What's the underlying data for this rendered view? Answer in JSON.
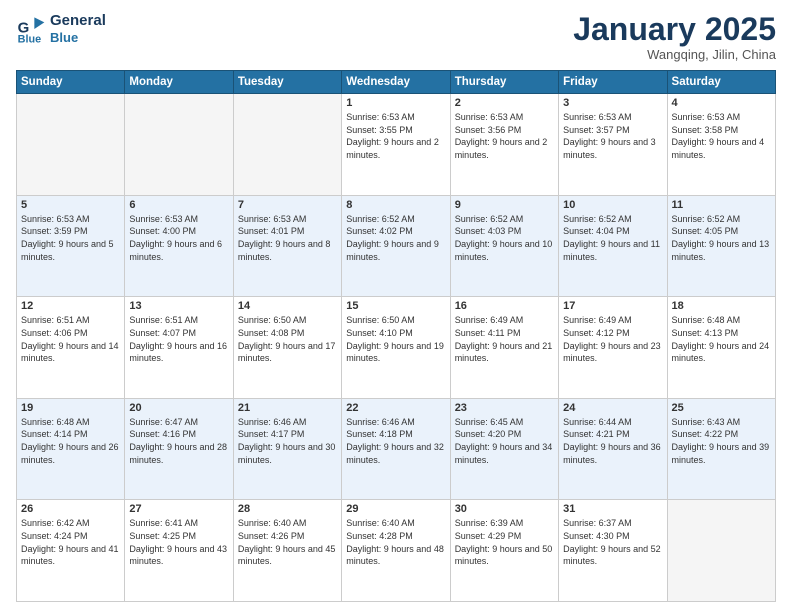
{
  "header": {
    "logo_line1": "General",
    "logo_line2": "Blue",
    "month": "January 2025",
    "location": "Wangqing, Jilin, China"
  },
  "weekdays": [
    "Sunday",
    "Monday",
    "Tuesday",
    "Wednesday",
    "Thursday",
    "Friday",
    "Saturday"
  ],
  "weeks": [
    [
      {
        "day": "",
        "info": ""
      },
      {
        "day": "",
        "info": ""
      },
      {
        "day": "",
        "info": ""
      },
      {
        "day": "1",
        "info": "Sunrise: 6:53 AM\nSunset: 3:55 PM\nDaylight: 9 hours and 2 minutes."
      },
      {
        "day": "2",
        "info": "Sunrise: 6:53 AM\nSunset: 3:56 PM\nDaylight: 9 hours and 2 minutes."
      },
      {
        "day": "3",
        "info": "Sunrise: 6:53 AM\nSunset: 3:57 PM\nDaylight: 9 hours and 3 minutes."
      },
      {
        "day": "4",
        "info": "Sunrise: 6:53 AM\nSunset: 3:58 PM\nDaylight: 9 hours and 4 minutes."
      }
    ],
    [
      {
        "day": "5",
        "info": "Sunrise: 6:53 AM\nSunset: 3:59 PM\nDaylight: 9 hours and 5 minutes."
      },
      {
        "day": "6",
        "info": "Sunrise: 6:53 AM\nSunset: 4:00 PM\nDaylight: 9 hours and 6 minutes."
      },
      {
        "day": "7",
        "info": "Sunrise: 6:53 AM\nSunset: 4:01 PM\nDaylight: 9 hours and 8 minutes."
      },
      {
        "day": "8",
        "info": "Sunrise: 6:52 AM\nSunset: 4:02 PM\nDaylight: 9 hours and 9 minutes."
      },
      {
        "day": "9",
        "info": "Sunrise: 6:52 AM\nSunset: 4:03 PM\nDaylight: 9 hours and 10 minutes."
      },
      {
        "day": "10",
        "info": "Sunrise: 6:52 AM\nSunset: 4:04 PM\nDaylight: 9 hours and 11 minutes."
      },
      {
        "day": "11",
        "info": "Sunrise: 6:52 AM\nSunset: 4:05 PM\nDaylight: 9 hours and 13 minutes."
      }
    ],
    [
      {
        "day": "12",
        "info": "Sunrise: 6:51 AM\nSunset: 4:06 PM\nDaylight: 9 hours and 14 minutes."
      },
      {
        "day": "13",
        "info": "Sunrise: 6:51 AM\nSunset: 4:07 PM\nDaylight: 9 hours and 16 minutes."
      },
      {
        "day": "14",
        "info": "Sunrise: 6:50 AM\nSunset: 4:08 PM\nDaylight: 9 hours and 17 minutes."
      },
      {
        "day": "15",
        "info": "Sunrise: 6:50 AM\nSunset: 4:10 PM\nDaylight: 9 hours and 19 minutes."
      },
      {
        "day": "16",
        "info": "Sunrise: 6:49 AM\nSunset: 4:11 PM\nDaylight: 9 hours and 21 minutes."
      },
      {
        "day": "17",
        "info": "Sunrise: 6:49 AM\nSunset: 4:12 PM\nDaylight: 9 hours and 23 minutes."
      },
      {
        "day": "18",
        "info": "Sunrise: 6:48 AM\nSunset: 4:13 PM\nDaylight: 9 hours and 24 minutes."
      }
    ],
    [
      {
        "day": "19",
        "info": "Sunrise: 6:48 AM\nSunset: 4:14 PM\nDaylight: 9 hours and 26 minutes."
      },
      {
        "day": "20",
        "info": "Sunrise: 6:47 AM\nSunset: 4:16 PM\nDaylight: 9 hours and 28 minutes."
      },
      {
        "day": "21",
        "info": "Sunrise: 6:46 AM\nSunset: 4:17 PM\nDaylight: 9 hours and 30 minutes."
      },
      {
        "day": "22",
        "info": "Sunrise: 6:46 AM\nSunset: 4:18 PM\nDaylight: 9 hours and 32 minutes."
      },
      {
        "day": "23",
        "info": "Sunrise: 6:45 AM\nSunset: 4:20 PM\nDaylight: 9 hours and 34 minutes."
      },
      {
        "day": "24",
        "info": "Sunrise: 6:44 AM\nSunset: 4:21 PM\nDaylight: 9 hours and 36 minutes."
      },
      {
        "day": "25",
        "info": "Sunrise: 6:43 AM\nSunset: 4:22 PM\nDaylight: 9 hours and 39 minutes."
      }
    ],
    [
      {
        "day": "26",
        "info": "Sunrise: 6:42 AM\nSunset: 4:24 PM\nDaylight: 9 hours and 41 minutes."
      },
      {
        "day": "27",
        "info": "Sunrise: 6:41 AM\nSunset: 4:25 PM\nDaylight: 9 hours and 43 minutes."
      },
      {
        "day": "28",
        "info": "Sunrise: 6:40 AM\nSunset: 4:26 PM\nDaylight: 9 hours and 45 minutes."
      },
      {
        "day": "29",
        "info": "Sunrise: 6:40 AM\nSunset: 4:28 PM\nDaylight: 9 hours and 48 minutes."
      },
      {
        "day": "30",
        "info": "Sunrise: 6:39 AM\nSunset: 4:29 PM\nDaylight: 9 hours and 50 minutes."
      },
      {
        "day": "31",
        "info": "Sunrise: 6:37 AM\nSunset: 4:30 PM\nDaylight: 9 hours and 52 minutes."
      },
      {
        "day": "",
        "info": ""
      }
    ]
  ]
}
